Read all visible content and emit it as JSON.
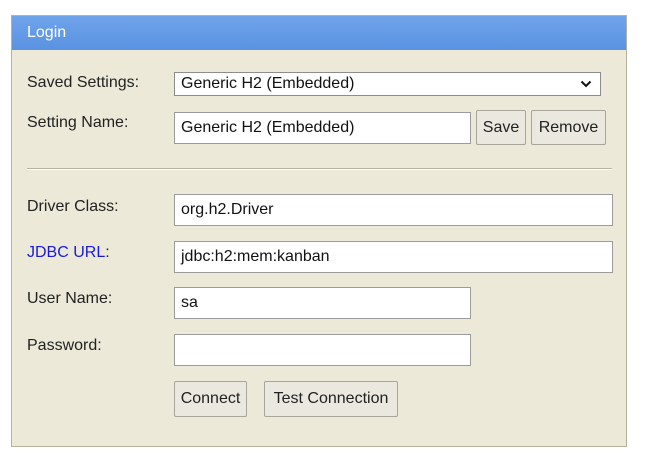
{
  "header": {
    "title": "Login"
  },
  "saved_settings": {
    "label": "Saved Settings:",
    "selected": "Generic H2 (Embedded)"
  },
  "setting_name": {
    "label": "Setting Name:",
    "value": "Generic H2 (Embedded)",
    "save_label": "Save",
    "remove_label": "Remove"
  },
  "driver_class": {
    "label": "Driver Class:",
    "value": "org.h2.Driver"
  },
  "jdbc_url": {
    "link_text": "JDBC URL",
    "suffix": ":",
    "value": "jdbc:h2:mem:kanban"
  },
  "user_name": {
    "label": "User Name:",
    "value": "sa"
  },
  "password": {
    "label": "Password:",
    "value": ""
  },
  "actions": {
    "connect_label": "Connect",
    "test_label": "Test Connection"
  },
  "icons": {
    "dropdown": "chevron-down-icon"
  }
}
